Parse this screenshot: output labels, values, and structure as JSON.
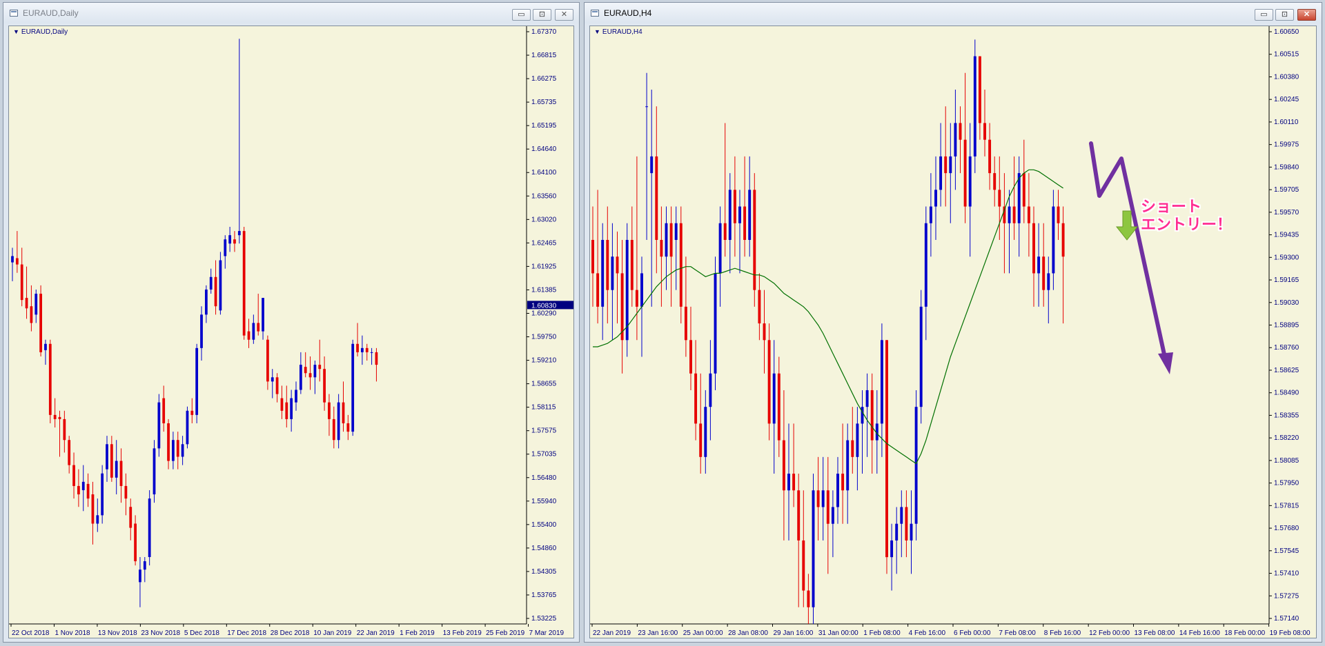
{
  "left_window": {
    "title": "EURAUD,Daily",
    "chart_label": "EURAUD,Daily",
    "controls": {
      "minimize": "▭",
      "maximize": "⊡",
      "close": "✕"
    }
  },
  "right_window": {
    "title": "EURAUD,H4",
    "chart_label": "EURAUD,H4",
    "controls": {
      "minimize": "▭",
      "maximize": "⊡",
      "close": "✕"
    },
    "annotation": {
      "line1": "ショート",
      "line2": "エントリー！"
    }
  },
  "colors": {
    "background": "#f5f4dc",
    "bull": "#0000cc",
    "bear": "#e60000",
    "ma": "#007000",
    "axis_text": "#000080",
    "annotation_arrow": "#7030a0",
    "entry_arrow": "#8dc63f",
    "annotation_text": "#ff2d91"
  },
  "chart_data": [
    {
      "type": "candlestick",
      "symbol": "EURAUD",
      "timeframe": "Daily",
      "y_ticks": [
        "1.67370",
        "1.66815",
        "1.66275",
        "1.65735",
        "1.65195",
        "1.64640",
        "1.64100",
        "1.63560",
        "1.63020",
        "1.62465",
        "1.61925",
        "1.61385",
        "1.60290",
        "1.59750",
        "1.59210",
        "1.58655",
        "1.58115",
        "1.57575",
        "1.57035",
        "1.56480",
        "1.55940",
        "1.55400",
        "1.54860",
        "1.54305",
        "1.53765",
        "1.53225"
      ],
      "x_labels": [
        "22 Oct 2018",
        "1 Nov 2018",
        "13 Nov 2018",
        "23 Nov 2018",
        "5 Dec 2018",
        "17 Dec 2018",
        "28 Dec 2018",
        "10 Jan 2019",
        "22 Jan 2019",
        "1 Feb 2019",
        "13 Feb 2019",
        "25 Feb 2019",
        "7 Mar 2019"
      ],
      "current_price": "1.60830",
      "ylim": [
        1.532,
        1.675
      ],
      "candles": [
        [
          1.6185,
          1.622,
          1.614,
          1.62
        ],
        [
          1.6195,
          1.626,
          1.616,
          1.618
        ],
        [
          1.618,
          1.622,
          1.608,
          1.6095
        ],
        [
          1.61,
          1.6175,
          1.605,
          1.6075
        ],
        [
          1.608,
          1.613,
          1.602,
          1.604
        ],
        [
          1.606,
          1.612,
          1.604,
          1.611
        ],
        [
          1.611,
          1.613,
          1.596,
          1.597
        ],
        [
          1.5975,
          1.6,
          1.594,
          1.599
        ],
        [
          1.599,
          1.6,
          1.58,
          1.582
        ],
        [
          1.582,
          1.586,
          1.579,
          1.581
        ],
        [
          1.5815,
          1.583,
          1.572,
          1.581
        ],
        [
          1.581,
          1.583,
          1.573,
          1.576
        ],
        [
          1.576,
          1.577,
          1.568,
          1.57
        ],
        [
          1.57,
          1.573,
          1.562,
          1.565
        ],
        [
          1.565,
          1.569,
          1.56,
          1.563
        ],
        [
          1.564,
          1.57,
          1.559,
          1.566
        ],
        [
          1.5655,
          1.568,
          1.56,
          1.562
        ],
        [
          1.563,
          1.566,
          1.551,
          1.556
        ],
        [
          1.556,
          1.562,
          1.554,
          1.558
        ],
        [
          1.558,
          1.57,
          1.556,
          1.568
        ],
        [
          1.569,
          1.577,
          1.566,
          1.575
        ],
        [
          1.575,
          1.577,
          1.566,
          1.567
        ],
        [
          1.567,
          1.576,
          1.563,
          1.571
        ],
        [
          1.571,
          1.574,
          1.561,
          1.565
        ],
        [
          1.565,
          1.568,
          1.558,
          1.562
        ],
        [
          1.56,
          1.562,
          1.552,
          1.555
        ],
        [
          1.556,
          1.558,
          1.546,
          1.547
        ],
        [
          1.542,
          1.548,
          1.536,
          1.545
        ],
        [
          1.545,
          1.548,
          1.542,
          1.547
        ],
        [
          1.548,
          1.564,
          1.546,
          1.562
        ],
        [
          1.563,
          1.576,
          1.561,
          1.574
        ],
        [
          1.574,
          1.587,
          1.572,
          1.585
        ],
        [
          1.586,
          1.589,
          1.578,
          1.58
        ],
        [
          1.58,
          1.581,
          1.569,
          1.571
        ],
        [
          1.571,
          1.578,
          1.569,
          1.576
        ],
        [
          1.576,
          1.578,
          1.569,
          1.572
        ],
        [
          1.572,
          1.577,
          1.57,
          1.575
        ],
        [
          1.575,
          1.584,
          1.574,
          1.583
        ],
        [
          1.583,
          1.586,
          1.58,
          1.582
        ],
        [
          1.582,
          1.599,
          1.58,
          1.598
        ],
        [
          1.598,
          1.608,
          1.595,
          1.606
        ],
        [
          1.606,
          1.613,
          1.604,
          1.612
        ],
        [
          1.612,
          1.617,
          1.611,
          1.615
        ],
        [
          1.615,
          1.619,
          1.606,
          1.608
        ],
        [
          1.607,
          1.621,
          1.606,
          1.619
        ],
        [
          1.62,
          1.625,
          1.617,
          1.624
        ],
        [
          1.623,
          1.627,
          1.621,
          1.625
        ],
        [
          1.624,
          1.626,
          1.621,
          1.623
        ],
        [
          1.625,
          1.672,
          1.623,
          1.626
        ],
        [
          1.626,
          1.627,
          1.6,
          1.601
        ],
        [
          1.602,
          1.605,
          1.598,
          1.6
        ],
        [
          1.6,
          1.606,
          1.599,
          1.604
        ],
        [
          1.604,
          1.611,
          1.601,
          1.602
        ],
        [
          1.602,
          1.61,
          1.6,
          1.61
        ],
        [
          1.6,
          1.601,
          1.588,
          1.59
        ],
        [
          1.59,
          1.593,
          1.586,
          1.591
        ],
        [
          1.591,
          1.592,
          1.585,
          1.587
        ],
        [
          1.586,
          1.589,
          1.581,
          1.583
        ],
        [
          1.585,
          1.589,
          1.579,
          1.581
        ],
        [
          1.581,
          1.588,
          1.578,
          1.586
        ],
        [
          1.585,
          1.59,
          1.583,
          1.588
        ],
        [
          1.588,
          1.597,
          1.587,
          1.594
        ],
        [
          1.5935,
          1.597,
          1.591,
          1.592
        ],
        [
          1.592,
          1.596,
          1.588,
          1.591
        ],
        [
          1.591,
          1.595,
          1.587,
          1.594
        ],
        [
          1.594,
          1.6,
          1.59,
          1.593
        ],
        [
          1.593,
          1.596,
          1.583,
          1.585
        ],
        [
          1.585,
          1.587,
          1.577,
          1.581
        ],
        [
          1.581,
          1.584,
          1.574,
          1.576
        ],
        [
          1.576,
          1.587,
          1.574,
          1.585
        ],
        [
          1.585,
          1.59,
          1.578,
          1.58
        ],
        [
          1.58,
          1.582,
          1.576,
          1.578
        ],
        [
          1.578,
          1.6,
          1.577,
          1.599
        ],
        [
          1.599,
          1.604,
          1.596,
          1.597
        ],
        [
          1.597,
          1.601,
          1.594,
          1.598
        ],
        [
          1.598,
          1.599,
          1.595,
          1.597
        ],
        [
          1.597,
          1.598,
          1.594,
          1.597
        ],
        [
          1.597,
          1.598,
          1.59,
          1.594
        ]
      ]
    },
    {
      "type": "candlestick",
      "symbol": "EURAUD",
      "timeframe": "H4",
      "y_ticks": [
        "1.60650",
        "1.60515",
        "1.60380",
        "1.60245",
        "1.60110",
        "1.59975",
        "1.59840",
        "1.59705",
        "1.59570",
        "1.59435",
        "1.59300",
        "1.59165",
        "1.59030",
        "1.58895",
        "1.58760",
        "1.58625",
        "1.58490",
        "1.58355",
        "1.58220",
        "1.58085",
        "1.57950",
        "1.57815",
        "1.57680",
        "1.57545",
        "1.57410",
        "1.57275",
        "1.57140"
      ],
      "x_labels": [
        "22 Jan 2019",
        "23 Jan 16:00",
        "25 Jan 00:00",
        "28 Jan 08:00",
        "29 Jan 16:00",
        "31 Jan 00:00",
        "1 Feb 08:00",
        "4 Feb 16:00",
        "6 Feb 00:00",
        "7 Feb 08:00",
        "8 Feb 16:00",
        "12 Feb 00:00",
        "13 Feb 08:00",
        "14 Feb 16:00",
        "18 Feb 00:00",
        "19 Feb 08:00"
      ],
      "ylim": [
        1.571,
        1.6068
      ],
      "candles": [
        [
          1.594,
          1.596,
          1.59,
          1.592
        ],
        [
          1.592,
          1.597,
          1.589,
          1.59
        ],
        [
          1.59,
          1.595,
          1.588,
          1.594
        ],
        [
          1.594,
          1.596,
          1.589,
          1.591
        ],
        [
          1.591,
          1.595,
          1.588,
          1.593
        ],
        [
          1.593,
          1.5945,
          1.589,
          1.592
        ],
        [
          1.592,
          1.594,
          1.586,
          1.588
        ],
        [
          1.588,
          1.595,
          1.587,
          1.594
        ],
        [
          1.594,
          1.596,
          1.59,
          1.591
        ],
        [
          1.591,
          1.599,
          1.588,
          1.59
        ],
        [
          1.59,
          1.593,
          1.587,
          1.592
        ],
        [
          1.602,
          1.604,
          1.594,
          1.602
        ],
        [
          1.598,
          1.603,
          1.59,
          1.599
        ],
        [
          1.599,
          1.602,
          1.592,
          1.594
        ],
        [
          1.594,
          1.596,
          1.59,
          1.593
        ],
        [
          1.593,
          1.596,
          1.591,
          1.595
        ],
        [
          1.595,
          1.596,
          1.59,
          1.593
        ],
        [
          1.594,
          1.596,
          1.591,
          1.595
        ],
        [
          1.595,
          1.596,
          1.589,
          1.59
        ],
        [
          1.59,
          1.593,
          1.587,
          1.588
        ],
        [
          1.588,
          1.59,
          1.585,
          1.586
        ],
        [
          1.586,
          1.588,
          1.582,
          1.583
        ],
        [
          1.583,
          1.586,
          1.58,
          1.581
        ],
        [
          1.581,
          1.585,
          1.58,
          1.584
        ],
        [
          1.584,
          1.588,
          1.582,
          1.586
        ],
        [
          1.586,
          1.593,
          1.585,
          1.592
        ],
        [
          1.592,
          1.596,
          1.59,
          1.595
        ],
        [
          1.595,
          1.601,
          1.593,
          1.594
        ],
        [
          1.594,
          1.598,
          1.592,
          1.597
        ],
        [
          1.597,
          1.599,
          1.593,
          1.595
        ],
        [
          1.595,
          1.597,
          1.592,
          1.596
        ],
        [
          1.596,
          1.599,
          1.593,
          1.594
        ],
        [
          1.594,
          1.599,
          1.593,
          1.597
        ],
        [
          1.597,
          1.598,
          1.59,
          1.591
        ],
        [
          1.591,
          1.592,
          1.588,
          1.589
        ],
        [
          1.589,
          1.591,
          1.586,
          1.588
        ],
        [
          1.588,
          1.589,
          1.582,
          1.583
        ],
        [
          1.583,
          1.588,
          1.58,
          1.586
        ],
        [
          1.586,
          1.587,
          1.581,
          1.582
        ],
        [
          1.582,
          1.585,
          1.576,
          1.579
        ],
        [
          1.579,
          1.583,
          1.576,
          1.58
        ],
        [
          1.58,
          1.583,
          1.578,
          1.579
        ],
        [
          1.579,
          1.58,
          1.572,
          1.576
        ],
        [
          1.576,
          1.579,
          1.572,
          1.573
        ],
        [
          1.573,
          1.574,
          1.571,
          1.572
        ],
        [
          1.572,
          1.58,
          1.571,
          1.579
        ],
        [
          1.579,
          1.581,
          1.576,
          1.578
        ],
        [
          1.578,
          1.581,
          1.576,
          1.579
        ],
        [
          1.579,
          1.581,
          1.574,
          1.577
        ],
        [
          1.577,
          1.579,
          1.575,
          1.578
        ],
        [
          1.578,
          1.581,
          1.577,
          1.58
        ],
        [
          1.58,
          1.583,
          1.577,
          1.579
        ],
        [
          1.579,
          1.583,
          1.577,
          1.582
        ],
        [
          1.582,
          1.584,
          1.58,
          1.581
        ],
        [
          1.581,
          1.584,
          1.579,
          1.583
        ],
        [
          1.583,
          1.585,
          1.58,
          1.584
        ],
        [
          1.584,
          1.586,
          1.581,
          1.585
        ],
        [
          1.585,
          1.586,
          1.58,
          1.582
        ],
        [
          1.582,
          1.585,
          1.58,
          1.583
        ],
        [
          1.583,
          1.589,
          1.581,
          1.588
        ],
        [
          1.588,
          1.588,
          1.574,
          1.575
        ],
        [
          1.575,
          1.577,
          1.573,
          1.576
        ],
        [
          1.576,
          1.578,
          1.574,
          1.577
        ],
        [
          1.577,
          1.579,
          1.575,
          1.578
        ],
        [
          1.578,
          1.579,
          1.575,
          1.576
        ],
        [
          1.576,
          1.579,
          1.574,
          1.577
        ],
        [
          1.577,
          1.585,
          1.576,
          1.584
        ],
        [
          1.584,
          1.591,
          1.583,
          1.59
        ],
        [
          1.59,
          1.596,
          1.588,
          1.595
        ],
        [
          1.595,
          1.598,
          1.593,
          1.596
        ],
        [
          1.596,
          1.599,
          1.594,
          1.597
        ],
        [
          1.597,
          1.601,
          1.596,
          1.599
        ],
        [
          1.599,
          1.602,
          1.596,
          1.598
        ],
        [
          1.598,
          1.601,
          1.595,
          1.599
        ],
        [
          1.599,
          1.603,
          1.597,
          1.601
        ],
        [
          1.601,
          1.602,
          1.598,
          1.6
        ],
        [
          1.6,
          1.604,
          1.595,
          1.596
        ],
        [
          1.596,
          1.601,
          1.593,
          1.599
        ],
        [
          1.599,
          1.606,
          1.598,
          1.605
        ],
        [
          1.605,
          1.605,
          1.6,
          1.601
        ],
        [
          1.601,
          1.603,
          1.599,
          1.6
        ],
        [
          1.6,
          1.601,
          1.597,
          1.598
        ],
        [
          1.598,
          1.599,
          1.596,
          1.597
        ],
        [
          1.597,
          1.599,
          1.594,
          1.596
        ],
        [
          1.596,
          1.598,
          1.592,
          1.595
        ],
        [
          1.595,
          1.597,
          1.592,
          1.596
        ],
        [
          1.596,
          1.599,
          1.594,
          1.595
        ],
        [
          1.595,
          1.599,
          1.593,
          1.598
        ],
        [
          1.598,
          1.6,
          1.595,
          1.596
        ],
        [
          1.596,
          1.598,
          1.593,
          1.595
        ],
        [
          1.595,
          1.596,
          1.59,
          1.592
        ],
        [
          1.592,
          1.595,
          1.59,
          1.593
        ],
        [
          1.593,
          1.595,
          1.59,
          1.591
        ],
        [
          1.591,
          1.593,
          1.589,
          1.592
        ],
        [
          1.592,
          1.597,
          1.591,
          1.596
        ],
        [
          1.596,
          1.597,
          1.594,
          1.595
        ],
        [
          1.595,
          1.596,
          1.589,
          1.593
        ]
      ],
      "moving_average": [
        1.5876,
        1.5876,
        1.5877,
        1.5878,
        1.588,
        1.5882,
        1.5885,
        1.5888,
        1.5892,
        1.5896,
        1.59,
        1.5904,
        1.5908,
        1.5912,
        1.5915,
        1.5918,
        1.592,
        1.5922,
        1.5923,
        1.5924,
        1.5924,
        1.5922,
        1.592,
        1.5918,
        1.5919,
        1.592,
        1.592,
        1.5921,
        1.5922,
        1.5923,
        1.5922,
        1.5921,
        1.592,
        1.5919,
        1.5919,
        1.5918,
        1.5916,
        1.5914,
        1.5911,
        1.5908,
        1.5906,
        1.5904,
        1.5902,
        1.59,
        1.5897,
        1.5893,
        1.5889,
        1.5884,
        1.5878,
        1.5872,
        1.5866,
        1.586,
        1.5854,
        1.5848,
        1.5842,
        1.5837,
        1.5832,
        1.5828,
        1.5824,
        1.5821,
        1.5818,
        1.5816,
        1.5814,
        1.5812,
        1.581,
        1.5808,
        1.5806,
        1.5812,
        1.582,
        1.583,
        1.584,
        1.585,
        1.586,
        1.587,
        1.5878,
        1.5886,
        1.5894,
        1.5902,
        1.591,
        1.5918,
        1.5926,
        1.5934,
        1.5942,
        1.595,
        1.5958,
        1.5966,
        1.5972,
        1.5977,
        1.598,
        1.5982,
        1.5982,
        1.5981,
        1.5979,
        1.5977,
        1.5975,
        1.5973,
        1.5971
      ],
      "ma_start_index": 0
    }
  ]
}
